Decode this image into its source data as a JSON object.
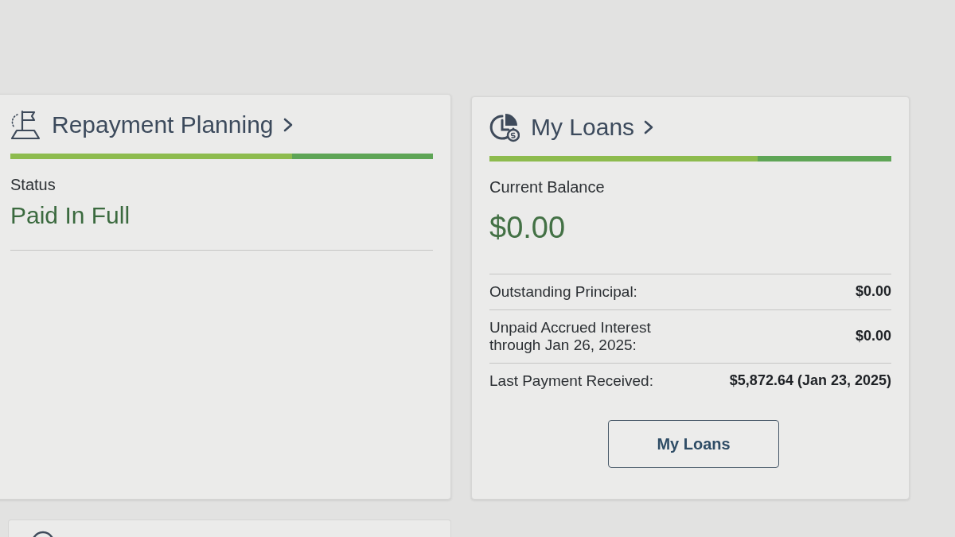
{
  "cards": [
    {
      "kind": "status",
      "title": "Repayment Planning",
      "label": "Status",
      "value": "Paid In Full"
    },
    {
      "kind": "balance",
      "title": "My Loans",
      "label": "Current Balance",
      "value": "$0.00",
      "rows": [
        {
          "label": "Outstanding Principal:",
          "value": "$0.00"
        },
        {
          "label": "Unpaid Accrued Interest through Jan 26, 2025:",
          "value": "$0.00"
        },
        {
          "label": "Last Payment Received:",
          "value": "$5,872.64 (Jan 23, 2025)"
        }
      ],
      "button": "My Loans"
    },
    {
      "kind": "partial"
    }
  ]
}
